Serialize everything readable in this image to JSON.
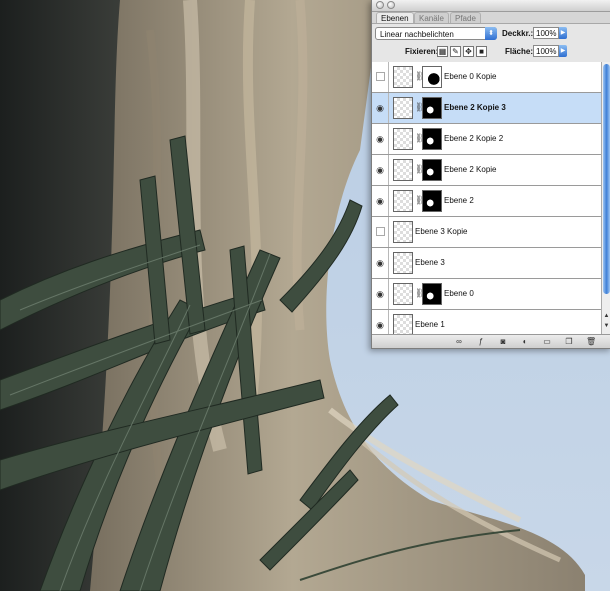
{
  "palette": {
    "tabs": [
      "Ebenen",
      "Kanäle",
      "Pfade"
    ],
    "blend_mode": "Linear nachbelichten",
    "opacity_label": "Deckkr.:",
    "opacity_value": "100%",
    "lock_label": "Fixieren:",
    "fill_label": "Fläche:",
    "fill_value": "100%",
    "layers": [
      {
        "name": "Ebene 0 Kopie",
        "visible": false,
        "selected": false,
        "mask": true
      },
      {
        "name": "Ebene 2 Kopie 3",
        "visible": true,
        "selected": true,
        "mask": true
      },
      {
        "name": "Ebene 2 Kopie 2",
        "visible": true,
        "selected": false,
        "mask": true
      },
      {
        "name": "Ebene 2 Kopie",
        "visible": true,
        "selected": false,
        "mask": true
      },
      {
        "name": "Ebene 2",
        "visible": true,
        "selected": false,
        "mask": true
      },
      {
        "name": "Ebene 3 Kopie",
        "visible": false,
        "selected": false,
        "mask": false
      },
      {
        "name": "Ebene 3",
        "visible": true,
        "selected": false,
        "mask": false
      },
      {
        "name": "Ebene 0",
        "visible": true,
        "selected": false,
        "mask": true
      },
      {
        "name": "Ebene 1",
        "visible": true,
        "selected": false,
        "mask": false
      }
    ],
    "icons": [
      "eye-icon",
      "chain-link-icon",
      "lock-icon",
      "move-icon",
      "brush-icon",
      "transparency-lock-icon",
      "fx-icon",
      "mask-icon",
      "adjustment-icon",
      "folder-icon",
      "new-layer-icon",
      "trash-icon"
    ]
  }
}
